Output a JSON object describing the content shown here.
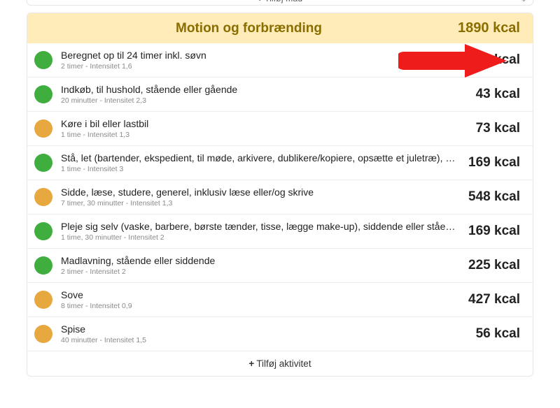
{
  "topbar": {
    "center_label": "Tilføj mad",
    "corner": ""
  },
  "header": {
    "title": "Motion og forbrænding",
    "total": "1890 kcal"
  },
  "kcal_unit": "kcal",
  "rows": [
    {
      "color": "green",
      "title": "Beregnet op til 24 timer inkl. søvn",
      "sub": "2 timer - Intensitet 1,6",
      "kcal": "180 kcal"
    },
    {
      "color": "green",
      "title": "Indkøb, til hushold, stående eller gående",
      "sub": "20 minutter - Intensitet 2,3",
      "kcal": "43 kcal"
    },
    {
      "color": "orange",
      "title": "Køre i bil eller lastbil",
      "sub": "1 time - Intensitet 1,3",
      "kcal": "73 kcal"
    },
    {
      "color": "green",
      "title": "Stå, let (bartender, ekspedient, til møde, arkivere, dublikere/kopiere, opsætte et juletræ), stå og sn…",
      "sub": "1 time - Intensitet 3",
      "kcal": "169 kcal"
    },
    {
      "color": "orange",
      "title": "Sidde, læse, studere, generel, inklusiv læse eller/og skrive",
      "sub": "7 timer, 30 minutter - Intensitet 1,3",
      "kcal": "548 kcal"
    },
    {
      "color": "green",
      "title": "Pleje sig selv (vaske, barbere, børste tænder, tisse, lægge make-up), siddende eller stående",
      "sub": "1 time, 30 minutter - Intensitet 2",
      "kcal": "169 kcal"
    },
    {
      "color": "green",
      "title": "Madlavning, stående eller siddende",
      "sub": "2 timer - Intensitet 2",
      "kcal": "225 kcal"
    },
    {
      "color": "orange",
      "title": "Sove",
      "sub": "8 timer - Intensitet 0,9",
      "kcal": "427 kcal"
    },
    {
      "color": "orange",
      "title": "Spise",
      "sub": "40 minutter - Intensitet 1,5",
      "kcal": "56 kcal"
    }
  ],
  "add_activity": {
    "plus": "+",
    "label": "Tilføj aktivitet"
  },
  "annotation": {
    "name": "red-arrow",
    "points_to_row_index": 0
  }
}
